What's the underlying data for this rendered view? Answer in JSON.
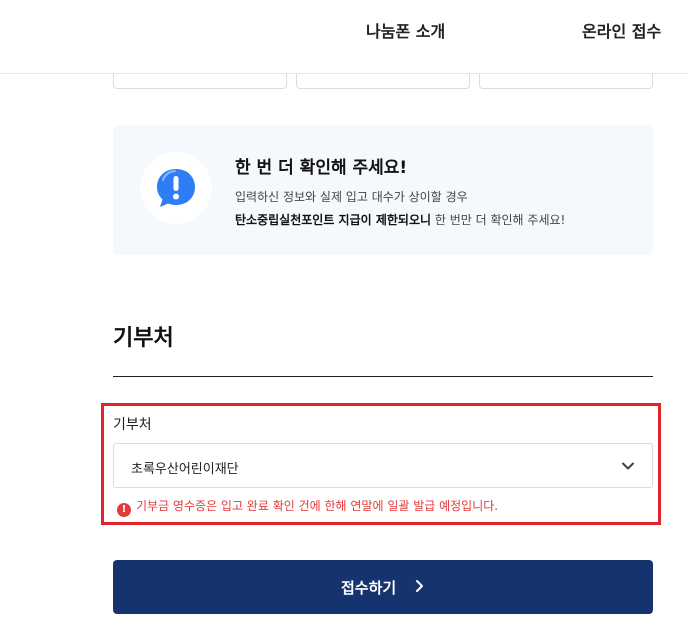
{
  "header": {
    "nav": [
      "나눔폰 소개",
      "온라인 접수"
    ]
  },
  "notice": {
    "icon": "exclamation-speech-bubble-icon",
    "title": "한 번 더 확인해 주세요!",
    "line1": "입력하신 정보와 실제 입고 대수가 상이할 경우",
    "line2_bold": "탄소중립실천포인트 지급이 제한되오니",
    "line2_rest": " 한 번만 더 확인해 주세요!"
  },
  "donation": {
    "section_title": "기부처",
    "field_label": "기부처",
    "selected": "초록우산어린이재단",
    "hint": "기부금 영수증은 입고 완료 확인 건에 한해 연말에 일괄 발급 예정입니다."
  },
  "submit": {
    "label": "접수하기"
  },
  "colors": {
    "accent": "#15336f",
    "error": "#e33b3b",
    "highlight": "#e3242b",
    "notice_bg": "#f5f8fd",
    "icon_blue": "#2f7df6"
  }
}
